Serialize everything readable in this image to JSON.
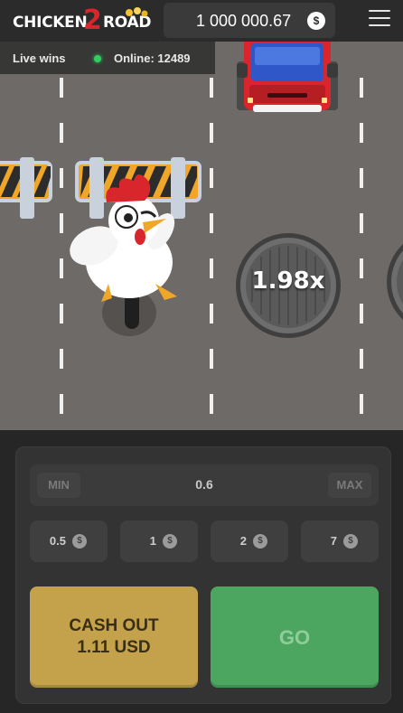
{
  "header": {
    "logo_word1": "CHICKEN",
    "logo_number": "2",
    "logo_word2": "ROAD",
    "balance": "1 000 000.67",
    "currency_icon": "$",
    "menu_icon": "hamburger-menu-icon"
  },
  "status": {
    "live_wins": "Live wins",
    "online": "Online: 12489",
    "online_color": "#2fd15e"
  },
  "game": {
    "next_multiplier": "1.98x",
    "lane_dash_color": "#ffffff",
    "road_color": "#6e6a67"
  },
  "controls": {
    "min_label": "MIN",
    "bet_amount": "0.6",
    "max_label": "MAX",
    "quick_bets": [
      {
        "label": "0.5",
        "coin": "$"
      },
      {
        "label": "1",
        "coin": "$"
      },
      {
        "label": "2",
        "coin": "$"
      },
      {
        "label": "7",
        "coin": "$"
      }
    ],
    "cashout_line1": "CASH OUT",
    "cashout_line2": "1.11 USD",
    "go_label": "GO",
    "cashout_color": "#c4a24c",
    "go_color": "#4da65f"
  }
}
